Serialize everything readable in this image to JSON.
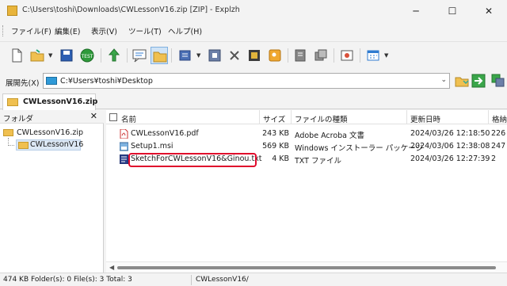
{
  "window": {
    "title": "C:\\Users\\toshi\\Downloads\\CWLessonV16.zip [ZIP] - Explzh",
    "minimize_glyph": "─",
    "maximize_glyph": "☐",
    "close_glyph": "✕"
  },
  "menu": [
    "ファイル(F)",
    "編集(E)",
    "表示(V)",
    "ツール(T)",
    "ヘルプ(H)"
  ],
  "address": {
    "label": "展開先(X)",
    "path": "C:¥Users¥toshi¥Desktop"
  },
  "tab": {
    "label": "CWLessonV16.zip"
  },
  "folder_pane": {
    "header": "フォルダ",
    "close_glyph": "✕",
    "tree": [
      "CWLessonV16.zip",
      "CWLessonV16"
    ]
  },
  "columns": [
    "名前",
    "サイズ",
    "ファイルの種類",
    "更新日時",
    "格納"
  ],
  "files": [
    {
      "name": "CWLessonV16.pdf",
      "size": "243 KB",
      "type": "Adobe Acroba 文書",
      "modified": "2024/03/26 12:18:50",
      "stored": "226",
      "icon": "pdf-icon"
    },
    {
      "name": "Setup1.msi",
      "size": "569 KB",
      "type": "Windows インストーラー パッケージ",
      "modified": "2024/03/06 12:38:08",
      "stored": "247",
      "icon": "msi-icon"
    },
    {
      "name": "SketchForCWLessonV16&Ginou.txt",
      "size": "4 KB",
      "type": "TXT ファイル",
      "modified": "2024/03/26 12:27:39",
      "stored": "2",
      "icon": "txt-icon"
    }
  ],
  "status": {
    "summary": "474 KB  Folder(s): 0  File(s): 3  Total: 3",
    "path": "CWLessonV16/"
  },
  "colors": {
    "highlight": "#e00a2c",
    "folder": "#f0c050",
    "accent": "#2f9ad8"
  }
}
